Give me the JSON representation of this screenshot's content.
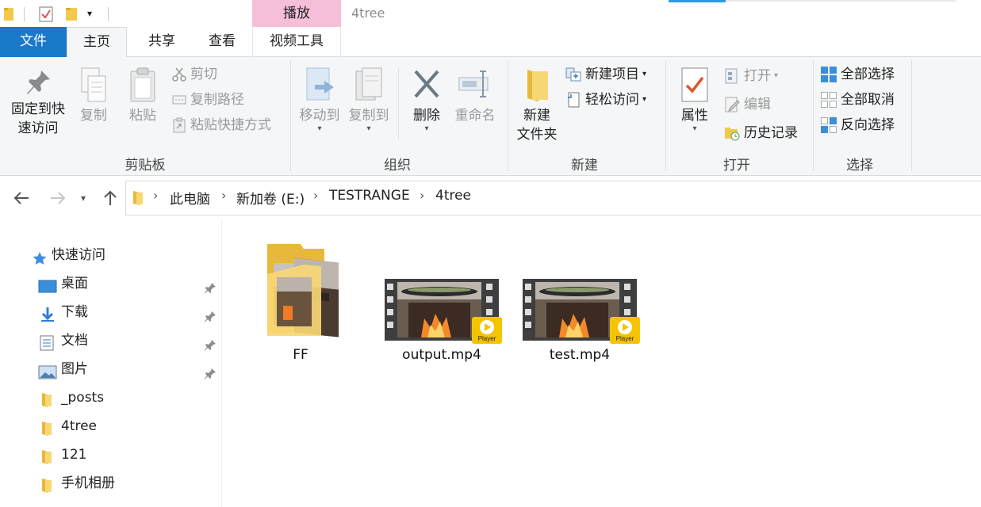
{
  "titlebar": {
    "context_tab": "播放",
    "window_title": "4tree"
  },
  "tabs": {
    "file": "文件",
    "home": "主页",
    "share": "共享",
    "view": "查看",
    "video_tools": "视频工具"
  },
  "ribbon": {
    "clipboard": {
      "group_label": "剪贴板",
      "pin_quick_access": [
        "固定到快",
        "速访问"
      ],
      "copy": "复制",
      "paste": "粘贴",
      "cut": "剪切",
      "copy_path": "复制路径",
      "paste_shortcut": "粘贴快捷方式"
    },
    "organize": {
      "group_label": "组织",
      "move_to": "移动到",
      "copy_to": "复制到",
      "delete": "删除",
      "rename": "重命名"
    },
    "new": {
      "group_label": "新建",
      "new_folder": [
        "新建",
        "文件夹"
      ],
      "new_item": "新建项目",
      "easy_access": "轻松访问"
    },
    "open": {
      "group_label": "打开",
      "properties": "属性",
      "open": "打开",
      "edit": "编辑",
      "history": "历史记录"
    },
    "select": {
      "group_label": "选择",
      "select_all": "全部选择",
      "select_none": "全部取消",
      "invert_selection": "反向选择"
    }
  },
  "address": {
    "crumbs": [
      "此电脑",
      "新加卷 (E:)",
      "TESTRANGE",
      "4tree"
    ]
  },
  "navpane": {
    "items": [
      {
        "label": "快速访问",
        "icon": "star-icon"
      },
      {
        "label": "桌面",
        "icon": "desktop-icon"
      },
      {
        "label": "下载",
        "icon": "download-icon"
      },
      {
        "label": "文档",
        "icon": "document-icon"
      },
      {
        "label": "图片",
        "icon": "pictures-icon"
      },
      {
        "label": "_posts",
        "icon": "folder-icon"
      },
      {
        "label": "4tree",
        "icon": "folder-icon"
      },
      {
        "label": "121",
        "icon": "folder-icon"
      },
      {
        "label": "手机相册",
        "icon": "folder-icon"
      }
    ]
  },
  "files": [
    {
      "name": "FF",
      "type": "folder"
    },
    {
      "name": "output.mp4",
      "type": "video",
      "badge": "Player"
    },
    {
      "name": "test.mp4",
      "type": "video",
      "badge": "Player"
    }
  ],
  "colors": {
    "file_tab": "#1979ca",
    "context_tab": "#f6bfd9",
    "accent": "#2a9ce0",
    "folder_yellow": "#f8d775"
  }
}
